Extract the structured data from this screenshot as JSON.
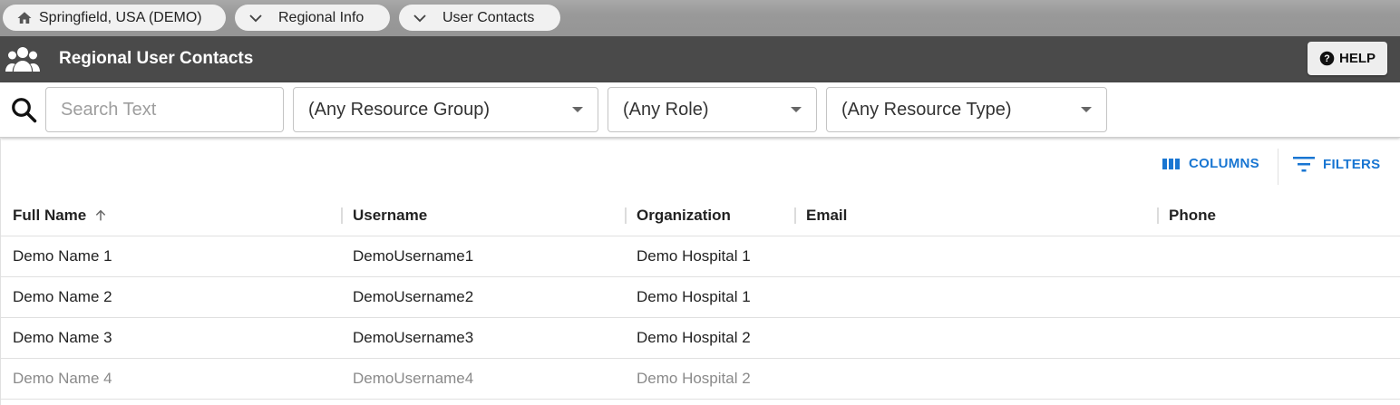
{
  "breadcrumbs": [
    {
      "label": "Springfield, USA (DEMO)",
      "icon": "home-icon"
    },
    {
      "label": "Regional Info",
      "icon": "chevron-down-icon"
    },
    {
      "label": "User Contacts",
      "icon": "chevron-down-icon"
    }
  ],
  "header": {
    "title": "Regional User Contacts",
    "icon": "users-icon",
    "help_label": "HELP"
  },
  "filters": {
    "search_placeholder": "Search Text",
    "search_value": "",
    "resource_group": "(Any Resource Group)",
    "role": "(Any Role)",
    "resource_type": "(Any Resource Type)"
  },
  "toolbar": {
    "columns_label": "COLUMNS",
    "filters_label": "FILTERS"
  },
  "table": {
    "columns": [
      "Full Name",
      "Username",
      "Organization",
      "Email",
      "Phone"
    ],
    "sort": {
      "column": "Full Name",
      "direction": "ascending"
    },
    "rows": [
      {
        "full_name": "Demo Name 1",
        "username": "DemoUsername1",
        "organization": "Demo Hospital 1",
        "email": "",
        "phone": ""
      },
      {
        "full_name": "Demo Name 2",
        "username": "DemoUsername2",
        "organization": "Demo Hospital 1",
        "email": "",
        "phone": ""
      },
      {
        "full_name": "Demo Name 3",
        "username": "DemoUsername3",
        "organization": "Demo Hospital 2",
        "email": "",
        "phone": ""
      },
      {
        "full_name": "Demo Name 4",
        "username": "DemoUsername4",
        "organization": "Demo Hospital 2",
        "email": "",
        "phone": ""
      }
    ]
  },
  "colors": {
    "accent": "#1976d2",
    "header_bg": "#4a4a4a",
    "breadcrumb_bg": "#9e9e9e"
  }
}
